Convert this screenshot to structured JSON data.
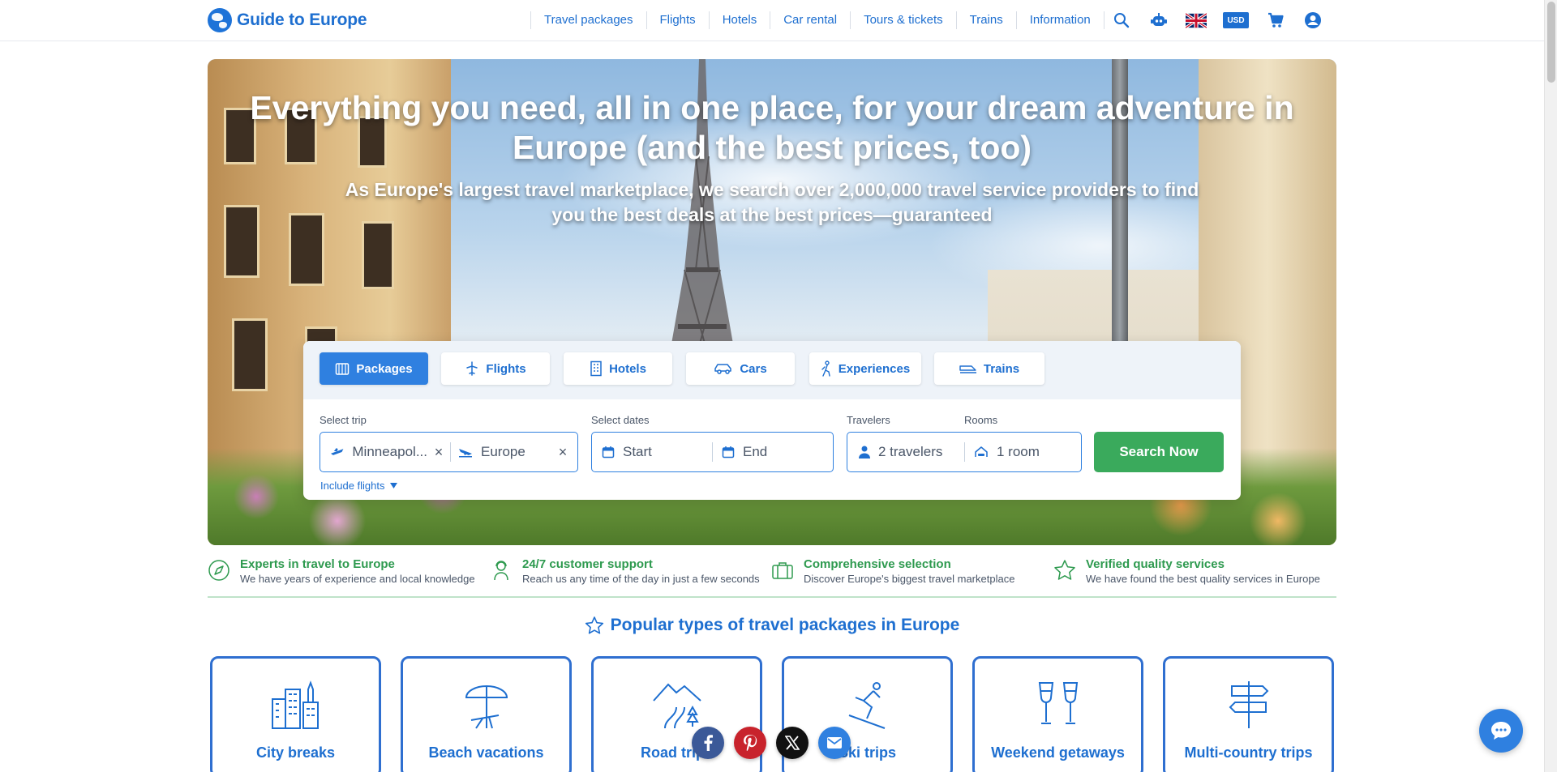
{
  "logo": {
    "text": "Guide to Europe"
  },
  "nav": {
    "items": [
      "Travel packages",
      "Flights",
      "Hotels",
      "Car rental",
      "Tours & tickets",
      "Trains",
      "Information"
    ]
  },
  "tools": {
    "currency": "USD",
    "icons": [
      "search-icon",
      "robot-icon",
      "uk-flag",
      "currency",
      "cart-icon",
      "account-icon"
    ]
  },
  "hero": {
    "title": "Everything you need, all in one place, for your dream adventure in Europe (and the best prices, too)",
    "subtitle": "As Europe's largest travel marketplace, we search over 2,000,000 travel service providers to find you the best deals at the best prices—guaranteed"
  },
  "widget": {
    "tabs": [
      {
        "label": "Packages",
        "icon": "packages-icon",
        "active": true
      },
      {
        "label": "Flights",
        "icon": "plane-icon",
        "active": false
      },
      {
        "label": "Hotels",
        "icon": "hotel-icon",
        "active": false
      },
      {
        "label": "Cars",
        "icon": "car-icon",
        "active": false
      },
      {
        "label": "Experiences",
        "icon": "hiker-icon",
        "active": false
      },
      {
        "label": "Trains",
        "icon": "train-icon",
        "active": false
      }
    ],
    "labels": {
      "trip": "Select trip",
      "dates": "Select dates",
      "travelers": "Travelers",
      "rooms": "Rooms"
    },
    "trip": {
      "from": "Minneapol...",
      "to": "Europe"
    },
    "dates": {
      "start_placeholder": "Start",
      "end_placeholder": "End"
    },
    "travelers_value": "2 travelers",
    "rooms_value": "1 room",
    "search_label": "Search Now",
    "include_flights": "Include flights"
  },
  "features": [
    {
      "title": "Experts in travel to Europe",
      "desc": "We have years of experience and local knowledge",
      "icon": "compass-icon"
    },
    {
      "title": "24/7 customer support",
      "desc": "Reach us any time of the day in just a few seconds",
      "icon": "support-agent-icon"
    },
    {
      "title": "Comprehensive selection",
      "desc": "Discover Europe's biggest travel marketplace",
      "icon": "luggage-icon"
    },
    {
      "title": "Verified quality services",
      "desc": "We have found the best quality services in Europe",
      "icon": "star-outline-icon"
    }
  ],
  "popular": {
    "title": "Popular types of travel packages in Europe",
    "cards": [
      {
        "label": "City breaks",
        "icon": "city-icon"
      },
      {
        "label": "Beach vacations",
        "icon": "beach-umbrella-icon"
      },
      {
        "label": "Road trips",
        "icon": "road-icon"
      },
      {
        "label": "Ski trips",
        "icon": "skier-icon"
      },
      {
        "label": "Weekend getaways",
        "icon": "wine-glasses-icon"
      },
      {
        "label": "Multi-country trips",
        "icon": "signpost-icon"
      }
    ]
  },
  "share": [
    "facebook",
    "pinterest",
    "x",
    "email"
  ],
  "colors": {
    "brand": "#1e6fd0",
    "accent_green": "#3aaa5c",
    "active_tab": "#2f80e0"
  }
}
